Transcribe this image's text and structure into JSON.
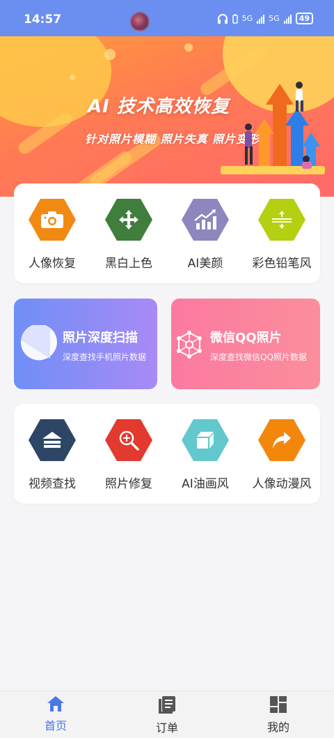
{
  "status_bar": {
    "time": "14:57",
    "network_1": "5G",
    "network_2": "5G",
    "battery": "49"
  },
  "banner": {
    "title": "AI 技术高效恢复",
    "subtitle": "针对照片模糊  照片失真  照片变形"
  },
  "row1": [
    {
      "label": "人像恢复",
      "icon": "camera-icon",
      "color": "#f18a12"
    },
    {
      "label": "黑白上色",
      "icon": "move-arrows-icon",
      "color": "#3f7e3d"
    },
    {
      "label": "AI美颜",
      "icon": "chart-up-icon",
      "color": "#8d86bf"
    },
    {
      "label": "彩色铅笔风",
      "icon": "resize-vertical-icon",
      "color": "#b5cf12"
    }
  ],
  "promo": [
    {
      "title": "照片深度扫描",
      "desc": "深度查找手机照片数据",
      "icon": "pie-scan-icon",
      "color_from": "#6f8ff7",
      "color_to": "#a98af5"
    },
    {
      "title": "微信QQ照片",
      "desc": "深度查找微信QQ照片数据",
      "icon": "network-hex-icon",
      "color_from": "#fb7aa0",
      "color_to": "#fb8e9c"
    }
  ],
  "row2": [
    {
      "label": "视频查找",
      "icon": "layers-icon",
      "color": "#2e4665"
    },
    {
      "label": "照片修复",
      "icon": "zoom-plus-icon",
      "color": "#e23a2e"
    },
    {
      "label": "AI油画风",
      "icon": "cube-icon",
      "color": "#62c8cd"
    },
    {
      "label": "人像动漫风",
      "icon": "share-arrow-icon",
      "color": "#f2870c"
    }
  ],
  "nav": [
    {
      "label": "首页",
      "icon": "home-icon",
      "active": true
    },
    {
      "label": "订单",
      "icon": "orders-icon",
      "active": false
    },
    {
      "label": "我的",
      "icon": "grid-profile-icon",
      "active": false
    }
  ]
}
